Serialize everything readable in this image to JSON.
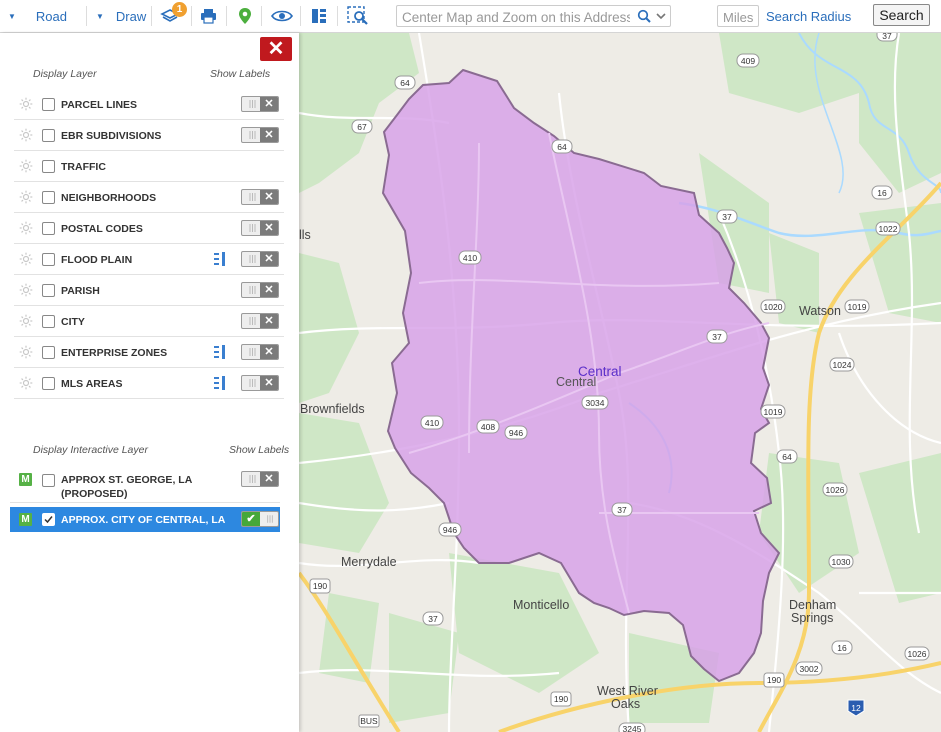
{
  "toolbar": {
    "road_label": "Road",
    "draw_label": "Draw",
    "layers_badge": "1",
    "address_placeholder": "Center Map and Zoom on this Address",
    "miles_placeholder": "Miles",
    "search_radius_label": "Search Radius",
    "search_button": "Search",
    "icons": [
      "chevron-down-icon",
      "layers-icon",
      "print-icon",
      "map-pin-icon",
      "eye-icon",
      "columns-icon",
      "zoom-area-icon",
      "search-icon"
    ]
  },
  "panel": {
    "close_label": "✕",
    "display_layer_header": "Display Layer",
    "show_labels_header": "Show Labels",
    "layers": [
      {
        "label": "PARCEL LINES",
        "legend": false,
        "toggle": true
      },
      {
        "label": "EBR SUBDIVISIONS",
        "legend": false,
        "toggle": true
      },
      {
        "label": "TRAFFIC",
        "legend": false,
        "toggle": false
      },
      {
        "label": "NEIGHBORHOODS",
        "legend": false,
        "toggle": true
      },
      {
        "label": "POSTAL CODES",
        "legend": false,
        "toggle": true
      },
      {
        "label": "FLOOD PLAIN",
        "legend": true,
        "toggle": true
      },
      {
        "label": "PARISH",
        "legend": false,
        "toggle": true
      },
      {
        "label": "CITY",
        "legend": false,
        "toggle": true
      },
      {
        "label": "ENTERPRISE ZONES",
        "legend": true,
        "toggle": true
      },
      {
        "label": "MLS AREAS",
        "legend": true,
        "toggle": true
      }
    ],
    "interactive_header": "Display Interactive Layer",
    "interactive_show_labels": "Show Labels",
    "interactive_layers": [
      {
        "badge": "M",
        "label_line1": "APPROX ST. GEORGE, LA",
        "label_line2": "(PROPOSED)",
        "checked": false,
        "labels_on": false
      },
      {
        "badge": "M",
        "label_line1": "APPROX. CITY OF CENTRAL, LA",
        "label_line2": "",
        "checked": true,
        "labels_on": true
      }
    ]
  },
  "map": {
    "boundary_label": "Central",
    "place_labels": [
      "Central",
      "Watson",
      "Brownfields",
      "Merrydale",
      "Monticello",
      "Denham",
      "Springs",
      "West River",
      "Oaks",
      "lls"
    ],
    "shields": [
      "37",
      "409",
      "64",
      "67",
      "64",
      "16",
      "1022",
      "37",
      "410",
      "1020",
      "1019",
      "37",
      "1024",
      "3034",
      "410",
      "408",
      "946",
      "1019",
      "64",
      "1026",
      "37",
      "946",
      "1030",
      "190",
      "37",
      "16",
      "3002",
      "190",
      "1026",
      "190",
      "12",
      "3245",
      "BUS"
    ],
    "colors": {
      "land": "#eeece6",
      "park": "#cfe7c6",
      "water": "#aadaff",
      "boundary_fill": "#d7a0e8",
      "boundary_stroke": "#8a6b92",
      "highway": "#f8d36a"
    }
  }
}
